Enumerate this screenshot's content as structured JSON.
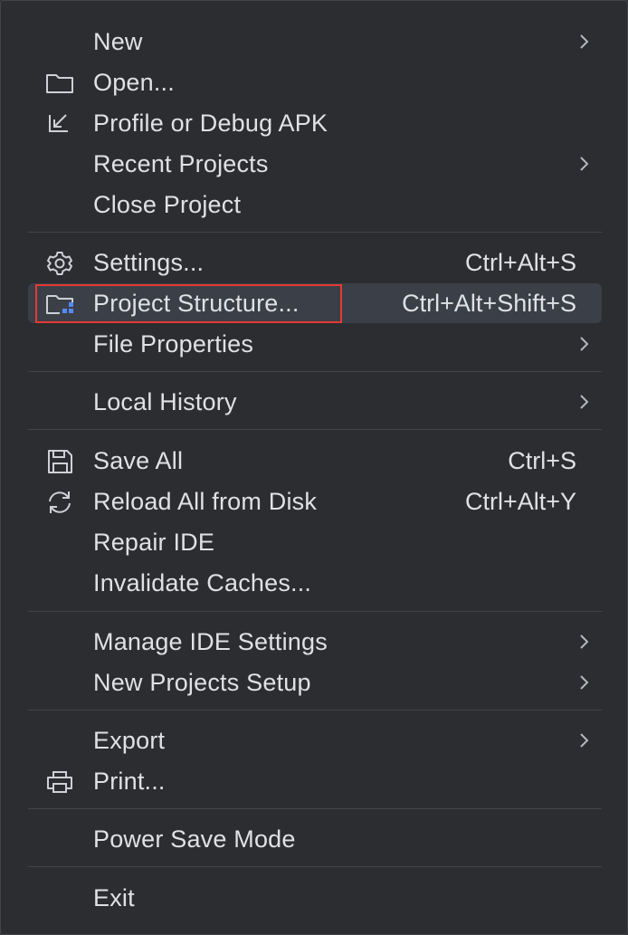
{
  "menu": {
    "new": {
      "label": "New"
    },
    "open": {
      "label": "Open..."
    },
    "profile_debug": {
      "label": "Profile or Debug APK"
    },
    "recent_projects": {
      "label": "Recent Projects"
    },
    "close_project": {
      "label": "Close Project"
    },
    "settings": {
      "label": "Settings...",
      "shortcut": "Ctrl+Alt+S"
    },
    "project_structure": {
      "label": "Project Structure...",
      "shortcut": "Ctrl+Alt+Shift+S"
    },
    "file_properties": {
      "label": "File Properties"
    },
    "local_history": {
      "label": "Local History"
    },
    "save_all": {
      "label": "Save All",
      "shortcut": "Ctrl+S"
    },
    "reload_all": {
      "label": "Reload All from Disk",
      "shortcut": "Ctrl+Alt+Y"
    },
    "repair_ide": {
      "label": "Repair IDE"
    },
    "invalidate_caches": {
      "label": "Invalidate Caches..."
    },
    "manage_ide_settings": {
      "label": "Manage IDE Settings"
    },
    "new_projects_setup": {
      "label": "New Projects Setup"
    },
    "export": {
      "label": "Export"
    },
    "print": {
      "label": "Print..."
    },
    "power_save_mode": {
      "label": "Power Save Mode"
    },
    "exit": {
      "label": "Exit"
    }
  },
  "icons": {
    "open": "folder-icon",
    "profile_debug": "arrow-down-left-icon",
    "settings": "gear-icon",
    "project_structure": "folder-structure-icon",
    "save_all": "floppy-disk-icon",
    "reload_all": "refresh-icon",
    "print": "printer-icon",
    "submenu": "chevron-right-icon"
  },
  "colors": {
    "background": "#2b2d30",
    "text": "#dfe1e5",
    "highlight": "#3b3f47",
    "separator": "#43454a",
    "focus_outline": "#e53935",
    "accent_blue": "#548af7"
  }
}
